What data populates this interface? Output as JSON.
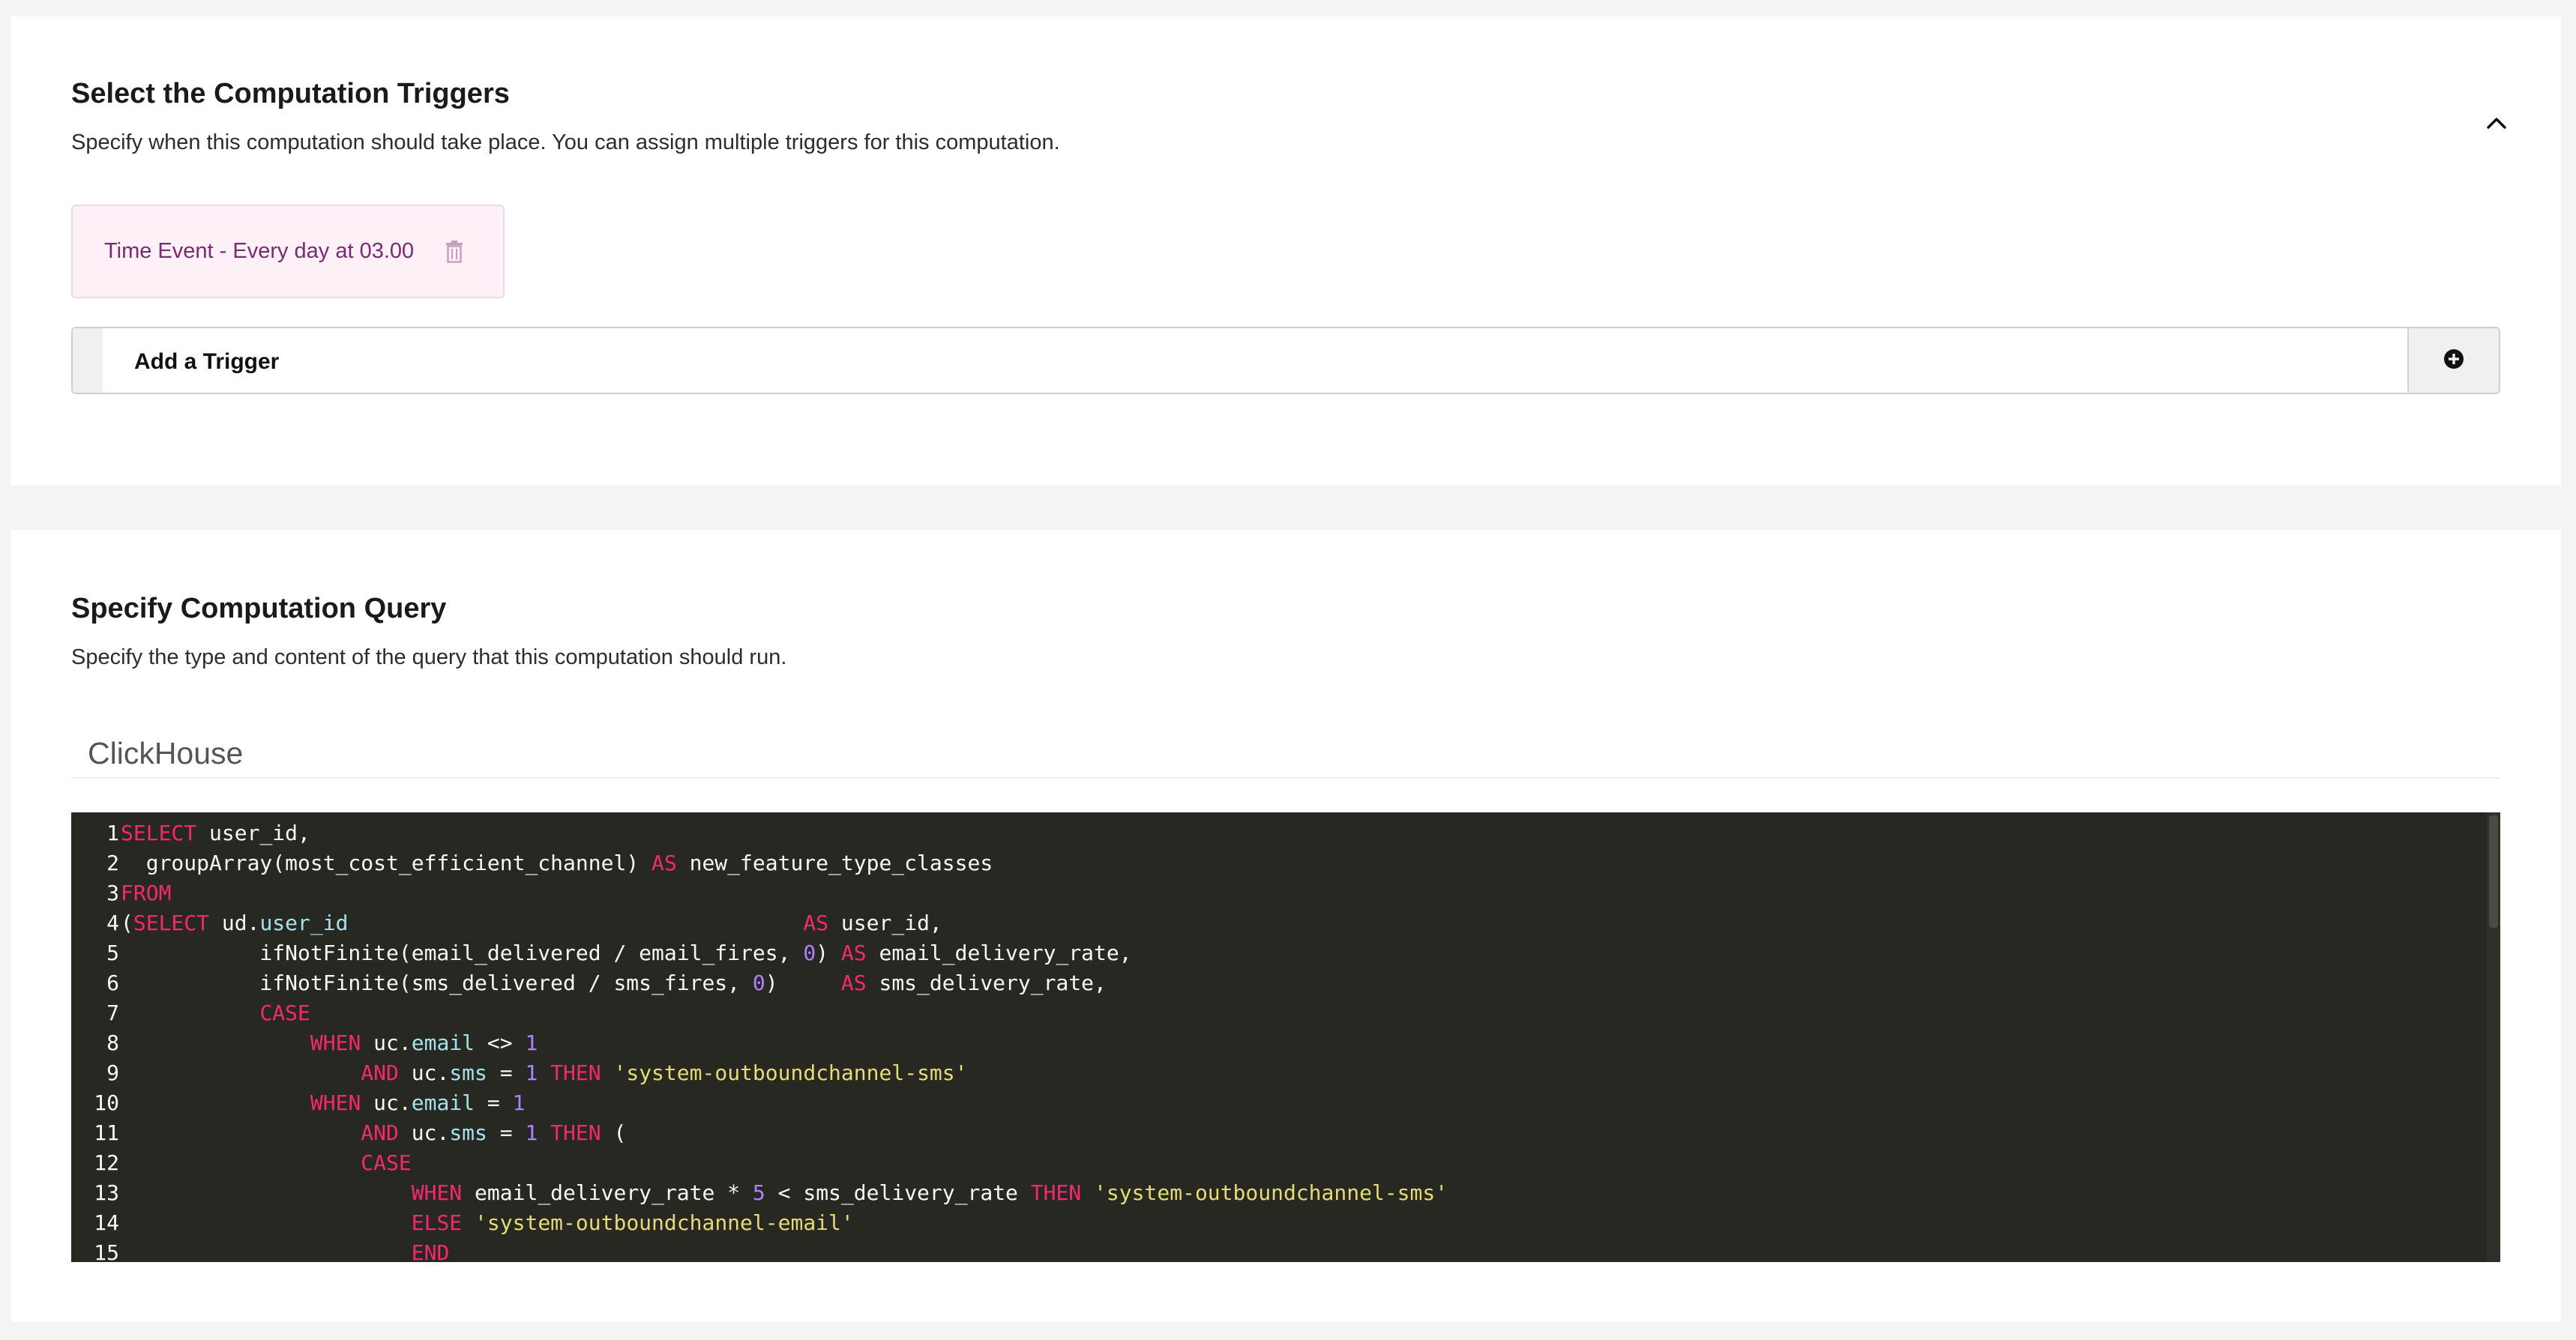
{
  "triggers_section": {
    "title": "Select the Computation Triggers",
    "description": "Specify when this computation should take place. You can assign multiple triggers for this computation.",
    "collapse_icon": "chevron-up-icon",
    "triggers": [
      {
        "label": "Time Event - Every day at 03.00",
        "delete_icon": "trash-icon"
      }
    ],
    "add_trigger_label": "Add a Trigger",
    "add_trigger_icon": "plus-circle-icon"
  },
  "query_section": {
    "title": "Specify Computation Query",
    "description": "Specify the type and content of the query that this computation should run.",
    "query_type": "ClickHouse"
  },
  "colors": {
    "keyword": "#f92672",
    "number": "#ae81ff",
    "string": "#e6db74",
    "field": "#a6e2ee",
    "editor_background": "#272822",
    "trigger_chip_background": "#fdf0f6",
    "trigger_chip_text": "#7a2a72"
  },
  "editor": {
    "lines": [
      {
        "n": "1",
        "tokens": [
          [
            "k",
            "SELECT"
          ],
          [
            "p",
            " user_id,"
          ]
        ]
      },
      {
        "n": "2",
        "tokens": [
          [
            "p",
            "  groupArray(most_cost_efficient_channel) "
          ],
          [
            "k",
            "AS"
          ],
          [
            "p",
            " new_feature_type_classes"
          ]
        ]
      },
      {
        "n": "3",
        "tokens": [
          [
            "k",
            "FROM"
          ]
        ]
      },
      {
        "n": "4",
        "tokens": [
          [
            "p",
            "("
          ],
          [
            "k",
            "SELECT"
          ],
          [
            "p",
            " ud."
          ],
          [
            "f",
            "user_id"
          ],
          [
            "p",
            "                                    "
          ],
          [
            "k",
            "AS"
          ],
          [
            "p",
            " user_id,"
          ]
        ]
      },
      {
        "n": "5",
        "tokens": [
          [
            "p",
            "           ifNotFinite(email_delivered / email_fires, "
          ],
          [
            "n",
            "0"
          ],
          [
            "p",
            ") "
          ],
          [
            "k",
            "AS"
          ],
          [
            "p",
            " email_delivery_rate,"
          ]
        ]
      },
      {
        "n": "6",
        "tokens": [
          [
            "p",
            "           ifNotFinite(sms_delivered / sms_fires, "
          ],
          [
            "n",
            "0"
          ],
          [
            "p",
            ")     "
          ],
          [
            "k",
            "AS"
          ],
          [
            "p",
            " sms_delivery_rate,"
          ]
        ]
      },
      {
        "n": "7",
        "tokens": [
          [
            "p",
            "           "
          ],
          [
            "k",
            "CASE"
          ]
        ]
      },
      {
        "n": "8",
        "tokens": [
          [
            "p",
            "               "
          ],
          [
            "k",
            "WHEN"
          ],
          [
            "p",
            " uc."
          ],
          [
            "f",
            "email"
          ],
          [
            "p",
            " <> "
          ],
          [
            "n",
            "1"
          ]
        ]
      },
      {
        "n": "9",
        "tokens": [
          [
            "p",
            "                   "
          ],
          [
            "k",
            "AND"
          ],
          [
            "p",
            " uc."
          ],
          [
            "f",
            "sms"
          ],
          [
            "p",
            " = "
          ],
          [
            "n",
            "1"
          ],
          [
            "p",
            " "
          ],
          [
            "k",
            "THEN"
          ],
          [
            "p",
            " "
          ],
          [
            "s",
            "'system-outboundchannel-sms'"
          ]
        ]
      },
      {
        "n": "10",
        "tokens": [
          [
            "p",
            "               "
          ],
          [
            "k",
            "WHEN"
          ],
          [
            "p",
            " uc."
          ],
          [
            "f",
            "email"
          ],
          [
            "p",
            " = "
          ],
          [
            "n",
            "1"
          ]
        ]
      },
      {
        "n": "11",
        "tokens": [
          [
            "p",
            "                   "
          ],
          [
            "k",
            "AND"
          ],
          [
            "p",
            " uc."
          ],
          [
            "f",
            "sms"
          ],
          [
            "p",
            " = "
          ],
          [
            "n",
            "1"
          ],
          [
            "p",
            " "
          ],
          [
            "k",
            "THEN"
          ],
          [
            "p",
            " ("
          ]
        ]
      },
      {
        "n": "12",
        "tokens": [
          [
            "p",
            "                   "
          ],
          [
            "k",
            "CASE"
          ]
        ]
      },
      {
        "n": "13",
        "tokens": [
          [
            "p",
            "                       "
          ],
          [
            "k",
            "WHEN"
          ],
          [
            "p",
            " email_delivery_rate * "
          ],
          [
            "n",
            "5"
          ],
          [
            "p",
            " < sms_delivery_rate "
          ],
          [
            "k",
            "THEN"
          ],
          [
            "p",
            " "
          ],
          [
            "s",
            "'system-outboundchannel-sms'"
          ]
        ]
      },
      {
        "n": "14",
        "tokens": [
          [
            "p",
            "                       "
          ],
          [
            "k",
            "ELSE"
          ],
          [
            "p",
            " "
          ],
          [
            "s",
            "'system-outboundchannel-email'"
          ]
        ]
      },
      {
        "n": "15",
        "tokens": [
          [
            "p",
            "                       "
          ],
          [
            "k",
            "END"
          ]
        ]
      }
    ]
  }
}
